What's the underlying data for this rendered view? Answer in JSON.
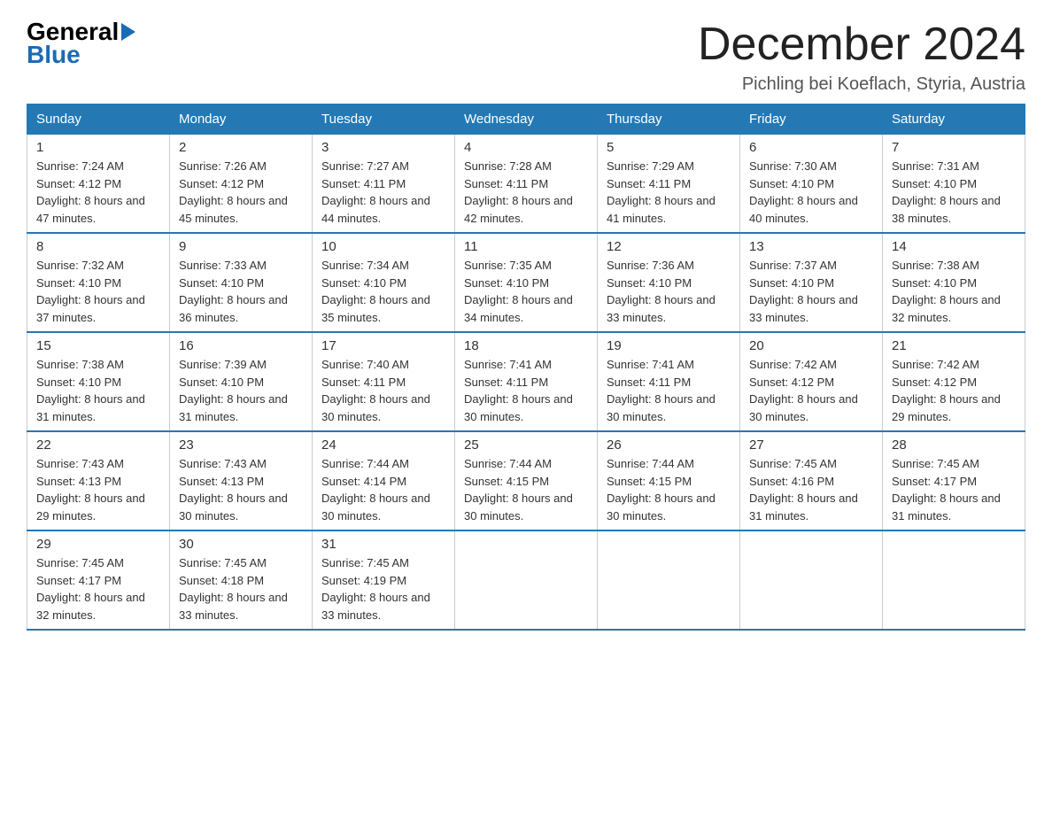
{
  "logo": {
    "general": "General",
    "blue": "Blue"
  },
  "title": "December 2024",
  "location": "Pichling bei Koeflach, Styria, Austria",
  "headers": [
    "Sunday",
    "Monday",
    "Tuesday",
    "Wednesday",
    "Thursday",
    "Friday",
    "Saturday"
  ],
  "weeks": [
    [
      {
        "day": "1",
        "sunrise": "7:24 AM",
        "sunset": "4:12 PM",
        "daylight": "8 hours and 47 minutes."
      },
      {
        "day": "2",
        "sunrise": "7:26 AM",
        "sunset": "4:12 PM",
        "daylight": "8 hours and 45 minutes."
      },
      {
        "day": "3",
        "sunrise": "7:27 AM",
        "sunset": "4:11 PM",
        "daylight": "8 hours and 44 minutes."
      },
      {
        "day": "4",
        "sunrise": "7:28 AM",
        "sunset": "4:11 PM",
        "daylight": "8 hours and 42 minutes."
      },
      {
        "day": "5",
        "sunrise": "7:29 AM",
        "sunset": "4:11 PM",
        "daylight": "8 hours and 41 minutes."
      },
      {
        "day": "6",
        "sunrise": "7:30 AM",
        "sunset": "4:10 PM",
        "daylight": "8 hours and 40 minutes."
      },
      {
        "day": "7",
        "sunrise": "7:31 AM",
        "sunset": "4:10 PM",
        "daylight": "8 hours and 38 minutes."
      }
    ],
    [
      {
        "day": "8",
        "sunrise": "7:32 AM",
        "sunset": "4:10 PM",
        "daylight": "8 hours and 37 minutes."
      },
      {
        "day": "9",
        "sunrise": "7:33 AM",
        "sunset": "4:10 PM",
        "daylight": "8 hours and 36 minutes."
      },
      {
        "day": "10",
        "sunrise": "7:34 AM",
        "sunset": "4:10 PM",
        "daylight": "8 hours and 35 minutes."
      },
      {
        "day": "11",
        "sunrise": "7:35 AM",
        "sunset": "4:10 PM",
        "daylight": "8 hours and 34 minutes."
      },
      {
        "day": "12",
        "sunrise": "7:36 AM",
        "sunset": "4:10 PM",
        "daylight": "8 hours and 33 minutes."
      },
      {
        "day": "13",
        "sunrise": "7:37 AM",
        "sunset": "4:10 PM",
        "daylight": "8 hours and 33 minutes."
      },
      {
        "day": "14",
        "sunrise": "7:38 AM",
        "sunset": "4:10 PM",
        "daylight": "8 hours and 32 minutes."
      }
    ],
    [
      {
        "day": "15",
        "sunrise": "7:38 AM",
        "sunset": "4:10 PM",
        "daylight": "8 hours and 31 minutes."
      },
      {
        "day": "16",
        "sunrise": "7:39 AM",
        "sunset": "4:10 PM",
        "daylight": "8 hours and 31 minutes."
      },
      {
        "day": "17",
        "sunrise": "7:40 AM",
        "sunset": "4:11 PM",
        "daylight": "8 hours and 30 minutes."
      },
      {
        "day": "18",
        "sunrise": "7:41 AM",
        "sunset": "4:11 PM",
        "daylight": "8 hours and 30 minutes."
      },
      {
        "day": "19",
        "sunrise": "7:41 AM",
        "sunset": "4:11 PM",
        "daylight": "8 hours and 30 minutes."
      },
      {
        "day": "20",
        "sunrise": "7:42 AM",
        "sunset": "4:12 PM",
        "daylight": "8 hours and 30 minutes."
      },
      {
        "day": "21",
        "sunrise": "7:42 AM",
        "sunset": "4:12 PM",
        "daylight": "8 hours and 29 minutes."
      }
    ],
    [
      {
        "day": "22",
        "sunrise": "7:43 AM",
        "sunset": "4:13 PM",
        "daylight": "8 hours and 29 minutes."
      },
      {
        "day": "23",
        "sunrise": "7:43 AM",
        "sunset": "4:13 PM",
        "daylight": "8 hours and 30 minutes."
      },
      {
        "day": "24",
        "sunrise": "7:44 AM",
        "sunset": "4:14 PM",
        "daylight": "8 hours and 30 minutes."
      },
      {
        "day": "25",
        "sunrise": "7:44 AM",
        "sunset": "4:15 PM",
        "daylight": "8 hours and 30 minutes."
      },
      {
        "day": "26",
        "sunrise": "7:44 AM",
        "sunset": "4:15 PM",
        "daylight": "8 hours and 30 minutes."
      },
      {
        "day": "27",
        "sunrise": "7:45 AM",
        "sunset": "4:16 PM",
        "daylight": "8 hours and 31 minutes."
      },
      {
        "day": "28",
        "sunrise": "7:45 AM",
        "sunset": "4:17 PM",
        "daylight": "8 hours and 31 minutes."
      }
    ],
    [
      {
        "day": "29",
        "sunrise": "7:45 AM",
        "sunset": "4:17 PM",
        "daylight": "8 hours and 32 minutes."
      },
      {
        "day": "30",
        "sunrise": "7:45 AM",
        "sunset": "4:18 PM",
        "daylight": "8 hours and 33 minutes."
      },
      {
        "day": "31",
        "sunrise": "7:45 AM",
        "sunset": "4:19 PM",
        "daylight": "8 hours and 33 minutes."
      },
      null,
      null,
      null,
      null
    ]
  ]
}
